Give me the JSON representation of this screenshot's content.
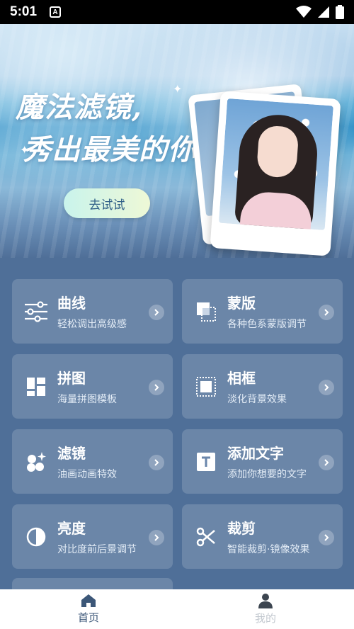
{
  "status_bar": {
    "time": "5:01",
    "app_icon": "A"
  },
  "banner": {
    "title_line1": "魔法滤镜,",
    "title_line2": "秀出最美的你",
    "try_button": "去试试"
  },
  "features": [
    {
      "title": "曲线",
      "subtitle": "轻松调出高级感",
      "icon": "sliders-icon"
    },
    {
      "title": "蒙版",
      "subtitle": "各种色系蒙版调节",
      "icon": "mask-layers-icon"
    },
    {
      "title": "拼图",
      "subtitle": "海量拼图模板",
      "icon": "collage-icon"
    },
    {
      "title": "相框",
      "subtitle": "淡化背景效果",
      "icon": "frame-icon"
    },
    {
      "title": "滤镜",
      "subtitle": "油画动画特效",
      "icon": "filter-icon"
    },
    {
      "title": "添加文字",
      "subtitle": "添加你想要的文字",
      "icon": "text-icon"
    },
    {
      "title": "亮度",
      "subtitle": "对比度前后景调节",
      "icon": "brightness-icon"
    },
    {
      "title": "裁剪",
      "subtitle": "智能裁剪·镜像效果",
      "icon": "scissors-icon"
    }
  ],
  "bottom_nav": [
    {
      "label": "首页",
      "icon": "home-icon",
      "active": true
    },
    {
      "label": "我的",
      "icon": "profile-icon",
      "active": false
    }
  ],
  "colors": {
    "background": "#4f6f98",
    "card": "rgba(255,255,255,0.16)",
    "active_nav": "#3c5778",
    "inactive_nav": "#c2c8cf"
  }
}
